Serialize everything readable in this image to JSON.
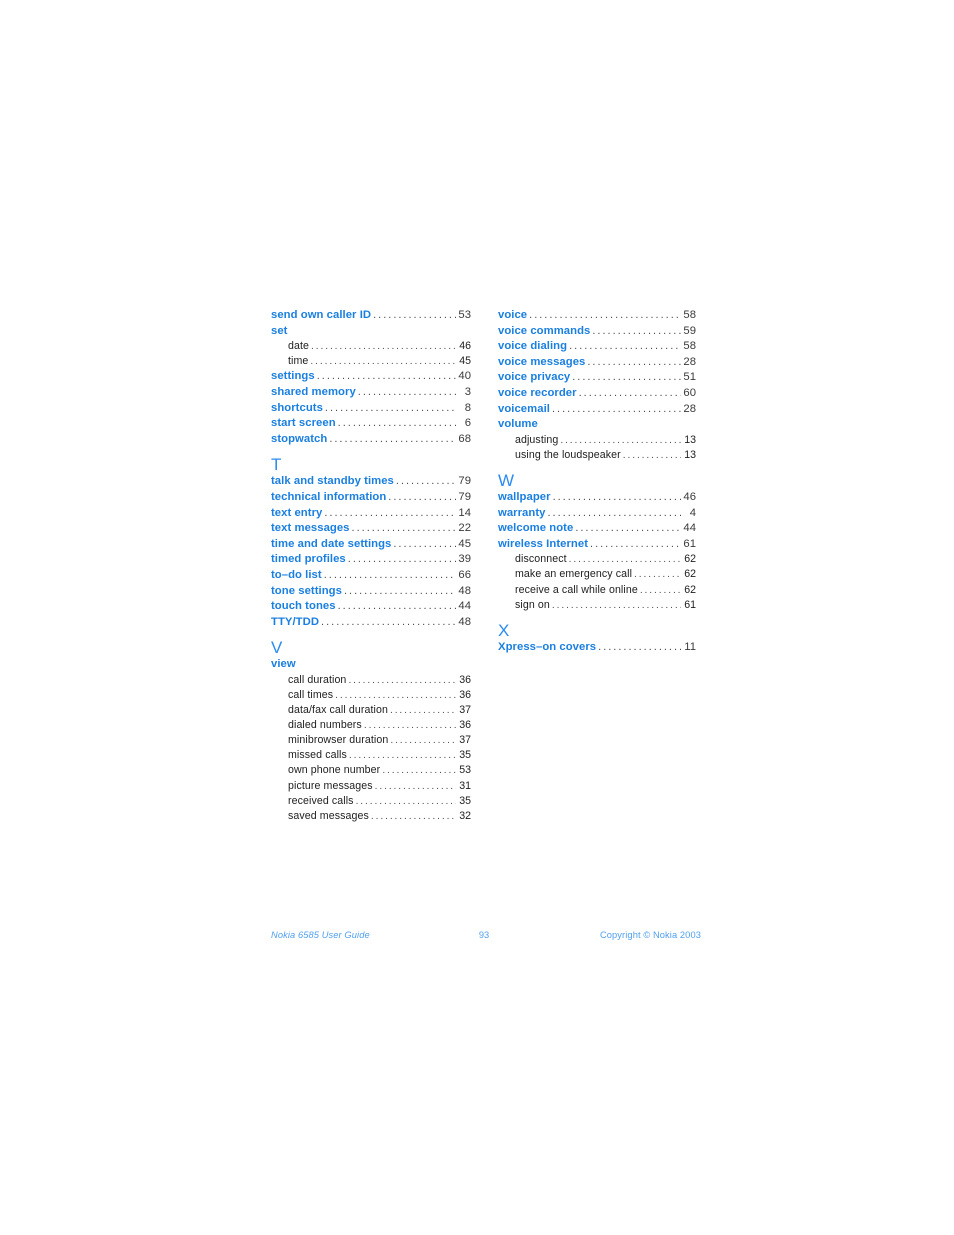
{
  "document": {
    "type": "index-page",
    "colors": {
      "entry_blue": "#1a7fe0",
      "section_letter_blue": "#2b8bf2",
      "footer_blue": "#4f9ff0",
      "subentry_black": "#1d1d1d",
      "page_background": "#ffffff"
    }
  },
  "columns": {
    "left": [
      {
        "kind": "entry",
        "label": "send own caller ID",
        "page": "53"
      },
      {
        "kind": "entry",
        "label": "set",
        "page": ""
      },
      {
        "kind": "sub",
        "label": "date",
        "page": "46"
      },
      {
        "kind": "sub",
        "label": "time",
        "page": "45"
      },
      {
        "kind": "entry",
        "label": "settings",
        "page": "40"
      },
      {
        "kind": "entry",
        "label": "shared memory",
        "page": "3"
      },
      {
        "kind": "entry",
        "label": "shortcuts",
        "page": "8"
      },
      {
        "kind": "entry",
        "label": "start screen",
        "page": "6"
      },
      {
        "kind": "entry",
        "label": "stopwatch",
        "page": "68"
      },
      {
        "kind": "letter",
        "label": "T"
      },
      {
        "kind": "entry",
        "label": "talk and standby times",
        "page": "79"
      },
      {
        "kind": "entry",
        "label": "technical information",
        "page": "79"
      },
      {
        "kind": "entry",
        "label": "text entry",
        "page": "14"
      },
      {
        "kind": "entry",
        "label": "text messages",
        "page": "22"
      },
      {
        "kind": "entry",
        "label": "time and date settings",
        "page": "45"
      },
      {
        "kind": "entry",
        "label": "timed profiles",
        "page": "39"
      },
      {
        "kind": "entry",
        "label": "to–do list",
        "page": "66"
      },
      {
        "kind": "entry",
        "label": "tone settings",
        "page": "48"
      },
      {
        "kind": "entry",
        "label": "touch tones",
        "page": "44"
      },
      {
        "kind": "entry",
        "label": "TTY/TDD",
        "page": "48"
      },
      {
        "kind": "letter",
        "label": "V"
      },
      {
        "kind": "entry",
        "label": "view",
        "page": ""
      },
      {
        "kind": "sub",
        "label": "call duration",
        "page": "36"
      },
      {
        "kind": "sub",
        "label": "call times",
        "page": "36"
      },
      {
        "kind": "sub",
        "label": "data/fax call duration",
        "page": "37"
      },
      {
        "kind": "sub",
        "label": "dialed numbers",
        "page": "36"
      },
      {
        "kind": "sub",
        "label": "minibrowser duration",
        "page": "37"
      },
      {
        "kind": "sub",
        "label": "missed calls",
        "page": "35"
      },
      {
        "kind": "sub",
        "label": "own phone number",
        "page": "53"
      },
      {
        "kind": "sub",
        "label": "picture messages",
        "page": "31"
      },
      {
        "kind": "sub",
        "label": "received calls",
        "page": "35"
      },
      {
        "kind": "sub",
        "label": "saved messages",
        "page": "32"
      }
    ],
    "right": [
      {
        "kind": "entry",
        "label": "voice",
        "page": "58"
      },
      {
        "kind": "entry",
        "label": "voice commands",
        "page": "59"
      },
      {
        "kind": "entry",
        "label": "voice dialing",
        "page": "58"
      },
      {
        "kind": "entry",
        "label": "voice messages",
        "page": "28"
      },
      {
        "kind": "entry",
        "label": "voice privacy",
        "page": "51"
      },
      {
        "kind": "entry",
        "label": "voice recorder",
        "page": "60"
      },
      {
        "kind": "entry",
        "label": "voicemail",
        "page": "28"
      },
      {
        "kind": "entry",
        "label": "volume",
        "page": ""
      },
      {
        "kind": "sub",
        "label": "adjusting",
        "page": "13"
      },
      {
        "kind": "sub",
        "label": "using the loudspeaker",
        "page": "13"
      },
      {
        "kind": "letter",
        "label": "W"
      },
      {
        "kind": "entry",
        "label": "wallpaper",
        "page": "46"
      },
      {
        "kind": "entry",
        "label": "warranty",
        "page": "4"
      },
      {
        "kind": "entry",
        "label": "welcome note",
        "page": "44"
      },
      {
        "kind": "entry",
        "label": "wireless Internet",
        "page": "61"
      },
      {
        "kind": "sub",
        "label": "disconnect",
        "page": "62"
      },
      {
        "kind": "sub",
        "label": "make an emergency call",
        "page": "62"
      },
      {
        "kind": "sub",
        "label": "receive a call while online",
        "page": "62"
      },
      {
        "kind": "sub",
        "label": "sign on",
        "page": "61"
      },
      {
        "kind": "letter",
        "label": "X"
      },
      {
        "kind": "entry",
        "label": "Xpress–on covers",
        "page": "11"
      }
    ]
  },
  "footer": {
    "left": "Nokia 6585 User Guide",
    "page_number": "93",
    "right": "Copyright © Nokia 2003"
  }
}
